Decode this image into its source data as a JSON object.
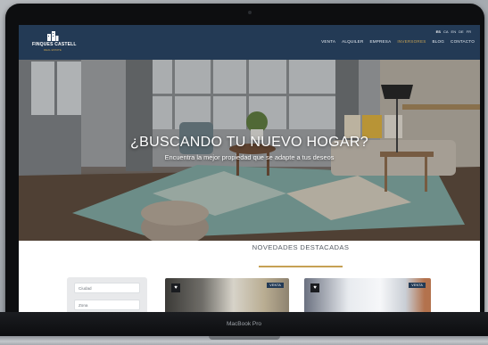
{
  "nav": {
    "brand_name": "FINQUES CASTELL",
    "brand_sub": "REAL ESTATE",
    "languages": [
      "ES",
      "CA",
      "EN",
      "DE",
      "FR"
    ],
    "active_language": "ES",
    "menu": [
      "VENTA",
      "ALQUILER",
      "EMPRESA",
      "INVERSORES",
      "BLOG",
      "CONTACTO"
    ],
    "active_menu": "INVERSORES"
  },
  "hero": {
    "title": "¿BUSCANDO TU NUEVO HOGAR?",
    "subtitle": "Encuentra la mejor propiedad que se adapte a tus deseos"
  },
  "section": {
    "title": "NOVEDADES DESTACADAS"
  },
  "filters": {
    "city_placeholder": "Ciudad",
    "zone_placeholder": "Zona"
  },
  "cards": [
    {
      "badge": "VENTA"
    },
    {
      "badge": "VENTA"
    }
  ],
  "device": {
    "label": "MacBook Pro"
  },
  "colors": {
    "nav": "#233a55",
    "accent": "#c6a154"
  }
}
